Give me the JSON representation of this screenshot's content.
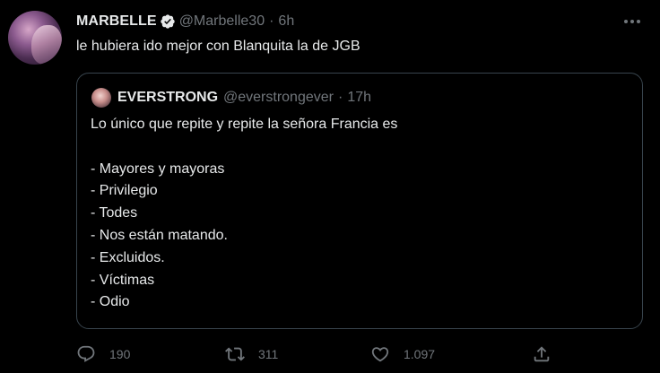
{
  "tweet": {
    "display_name": "MARBELLE",
    "handle": "@Marbelle30",
    "separator": "·",
    "time": "6h",
    "text": "le hubiera ido mejor con Blanquita la de JGB"
  },
  "quoted": {
    "display_name": "EVERSTRONG",
    "handle": "@everstrongever",
    "separator": "·",
    "time": "17h",
    "lines": [
      "Lo único que repite y repite la señora Francia es",
      "",
      "- Mayores y mayoras",
      "- Privilegio",
      "- Todes",
      "- Nos están matando.",
      "- Excluidos.",
      "- Víctimas",
      "- Odio"
    ]
  },
  "actions": {
    "reply_count": "190",
    "retweet_count": "311",
    "like_count": "1.097"
  },
  "icons": {
    "verified": "verified-badge-icon",
    "more": "more-icon",
    "reply": "reply-icon",
    "retweet": "retweet-icon",
    "like": "heart-icon",
    "share": "share-icon"
  },
  "colors": {
    "background": "#000000",
    "text": "#e7e9ea",
    "muted": "#71767b",
    "border": "#38444d"
  }
}
